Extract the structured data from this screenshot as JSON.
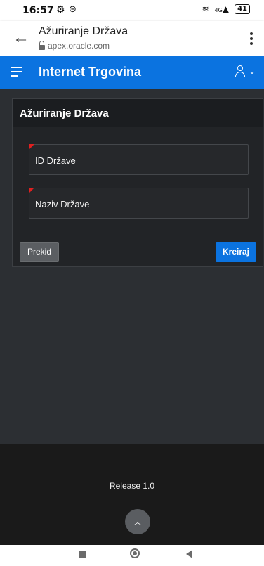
{
  "status_bar": {
    "time": "16:57",
    "network": "4G",
    "battery": "41"
  },
  "browser": {
    "title": "Ažuriranje Država",
    "url": "apex.oracle.com"
  },
  "app": {
    "title": "Internet Trgovina"
  },
  "region": {
    "title": "Ažuriranje Država",
    "fields": [
      {
        "label": "ID Države",
        "required": true
      },
      {
        "label": "Naziv Države",
        "required": true
      }
    ],
    "cancel_label": "Prekid",
    "create_label": "Kreiraj"
  },
  "footer": {
    "release": "Release 1.0"
  },
  "colors": {
    "accent": "#0b73e0",
    "background": "#2c2f33",
    "required": "#e02020"
  }
}
